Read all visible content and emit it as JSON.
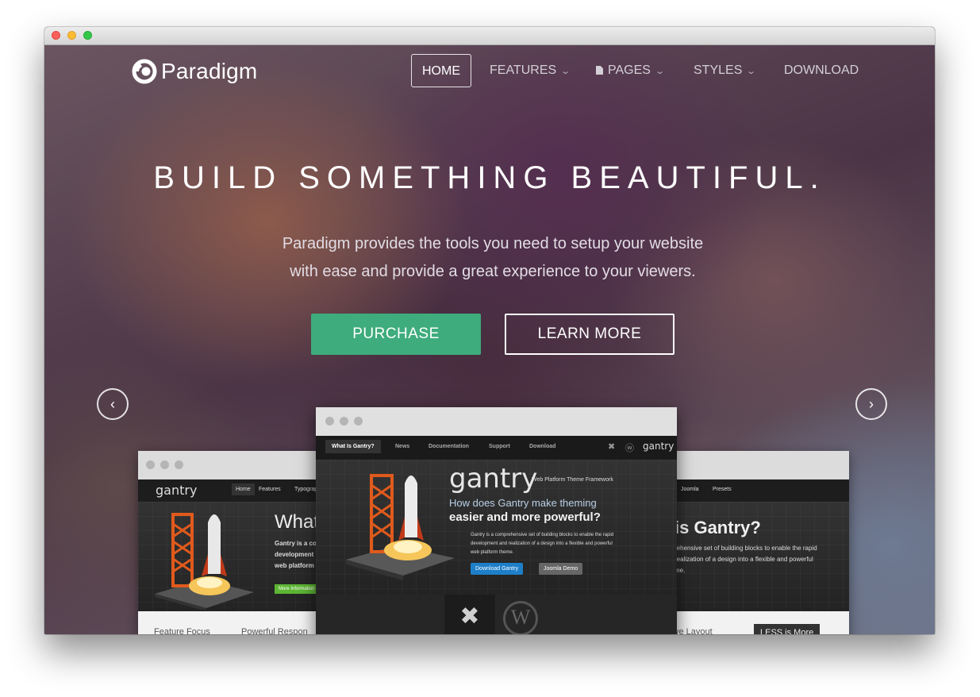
{
  "brand": {
    "name": "Paradigm"
  },
  "nav": {
    "home": "HOME",
    "features": "FEATURES",
    "pages": "PAGES",
    "styles": "STYLES",
    "download": "DOWNLOAD"
  },
  "hero": {
    "headline": "BUILD SOMETHING BEAUTIFUL.",
    "subtext": "Paradigm provides the tools you need to setup your website with ease and provide a great experience to your viewers.",
    "purchase": "PURCHASE",
    "learn_more": "LEARN MORE"
  },
  "colors": {
    "accent": "#3eac7c"
  },
  "mockup_center": {
    "tabs": [
      "What Is Gantry?",
      "News",
      "Documentation",
      "Support",
      "Download"
    ],
    "logo": "gantry",
    "logo_tagline": "Web Platform Theme Framework",
    "heading_1": "How does Gantry make theming",
    "heading_2": "easier and more powerful?",
    "desc_1": "Gantry is a comprehensive set of building blocks to enable the rapid",
    "desc_2": "development and realization of a design into a flexible and powerful",
    "desc_3": "web platform theme.",
    "btn_download": "Download Gantry",
    "btn_demo": "Joomla Demo"
  },
  "mockup_left": {
    "logo": "gantry",
    "nav": [
      "Home",
      "Features",
      "Typograp"
    ],
    "heading": "What",
    "lines": [
      "Gantry is a co",
      "development",
      "web platform"
    ],
    "btn": "More Information",
    "footer": [
      "Feature Focus",
      "Powerful Respon"
    ]
  },
  "mockup_right": {
    "nav": [
      "Joomla",
      "Presets"
    ],
    "heading": "is Gantry?",
    "lines": [
      "rehensive set of building blocks to enable the rapid",
      "realization of a design into a flexible and powerful",
      "me."
    ],
    "footer_left": "ve Layout",
    "footer_btn": "LESS is More"
  }
}
